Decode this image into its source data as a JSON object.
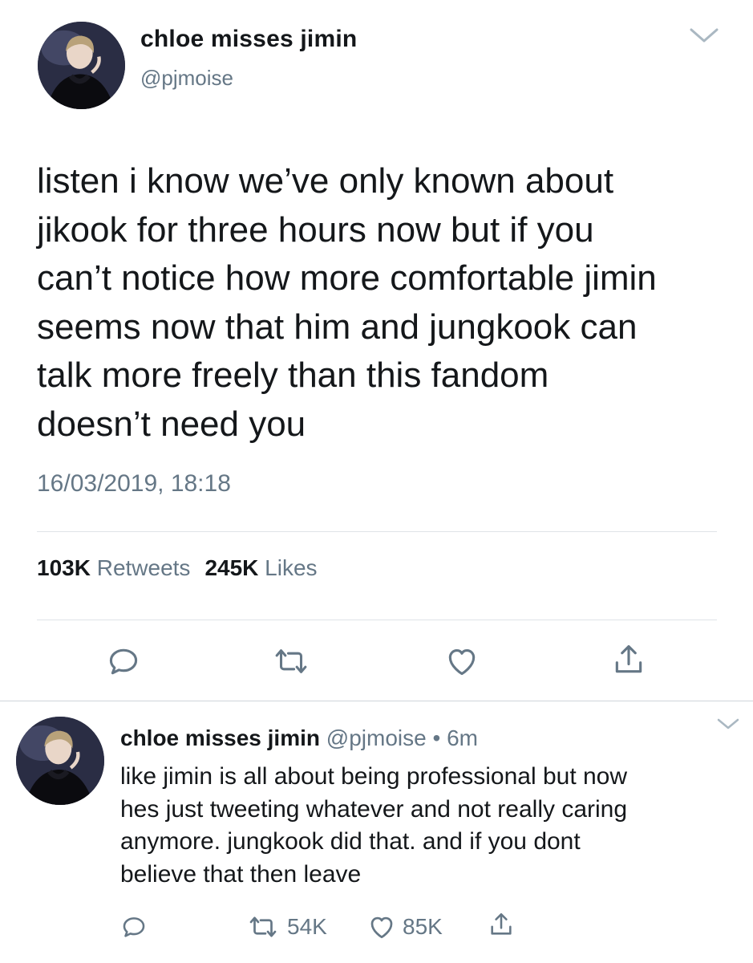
{
  "main_tweet": {
    "display_name": "chloe misses jimin",
    "handle": "@pjmoise",
    "text": "listen i know we’ve only known about\njikook for three hours now but if you\ncan’t notice how more comfortable jimin\nseems now that him and jungkook can\ntalk more freely than this fandom\ndoesn’t need you",
    "timestamp": "16/03/2019, 18:18",
    "retweet_count": "103K",
    "retweet_label": "Retweets",
    "like_count": "245K",
    "like_label": "Likes",
    "icons": [
      "avatar-photo",
      "chevron-down-icon",
      "reply-icon",
      "retweet-icon",
      "like-icon",
      "share-icon"
    ]
  },
  "reply_tweet": {
    "display_name": "chloe misses jimin",
    "handle": "@pjmoise",
    "separator": "•",
    "time": "6m",
    "text": "like jimin is all about being professional but now\nhes just tweeting whatever and not really caring\nanymore. jungkook did that. and if you dont\nbelieve that then leave",
    "retweet_count": "54K",
    "like_count": "85K",
    "icons": [
      "avatar-photo",
      "chevron-down-icon",
      "reply-icon",
      "retweet-icon",
      "like-icon",
      "share-icon"
    ]
  },
  "colors": {
    "text_primary": "#14171a",
    "text_secondary": "#657786",
    "icon_gray": "#657786",
    "divider": "#dfe3e7"
  }
}
